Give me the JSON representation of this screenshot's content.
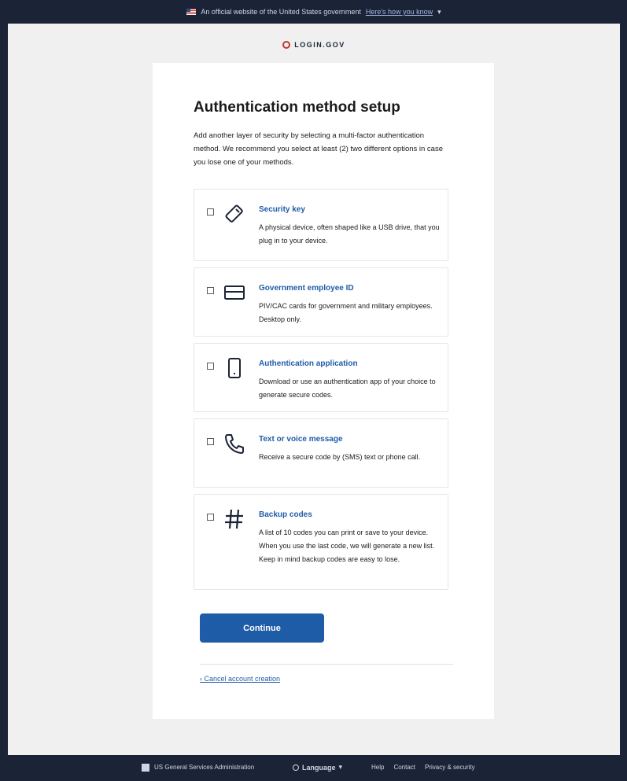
{
  "banner": {
    "text": "An official website of the United States government",
    "link": "Here's how you know"
  },
  "logo": {
    "text": "LOGIN.GOV"
  },
  "page": {
    "title": "Authentication method setup",
    "intro": "Add another layer of security by selecting a multi-factor authentication method. We recommend you select at least (2) two different options in case you lose one of your methods."
  },
  "options": [
    {
      "icon": "security-key-icon",
      "title": "Security key",
      "description": "A physical device, often shaped like a USB drive, that you plug in to your device.",
      "checked": false
    },
    {
      "icon": "id-card-icon",
      "title": "Government employee ID",
      "description": "PIV/CAC cards for government and military employees. Desktop only.",
      "checked": false
    },
    {
      "icon": "phone-icon",
      "title": "Authentication application",
      "description": "Download or use an authentication app of your choice to generate secure codes.",
      "checked": false
    },
    {
      "icon": "telephone-icon",
      "title": "Text or voice message",
      "description": "Receive a secure code by (SMS) text or phone call.",
      "checked": false
    },
    {
      "icon": "backup-codes-icon",
      "title": "Backup codes",
      "description": "A list of 10 codes you can print or save to your device. When you use the last code, we will generate a new list. Keep in mind backup codes are easy to lose.",
      "checked": false
    }
  ],
  "actions": {
    "continue": "Continue",
    "cancel": "‹ Cancel account creation"
  },
  "footer": {
    "agency": "US General Services Administration",
    "language": "Language",
    "links": [
      "Help",
      "Contact",
      "Privacy & security"
    ]
  },
  "colors": {
    "primary": "#1f5ca8",
    "navy": "#1b2436",
    "accent_red": "#c0392b"
  }
}
